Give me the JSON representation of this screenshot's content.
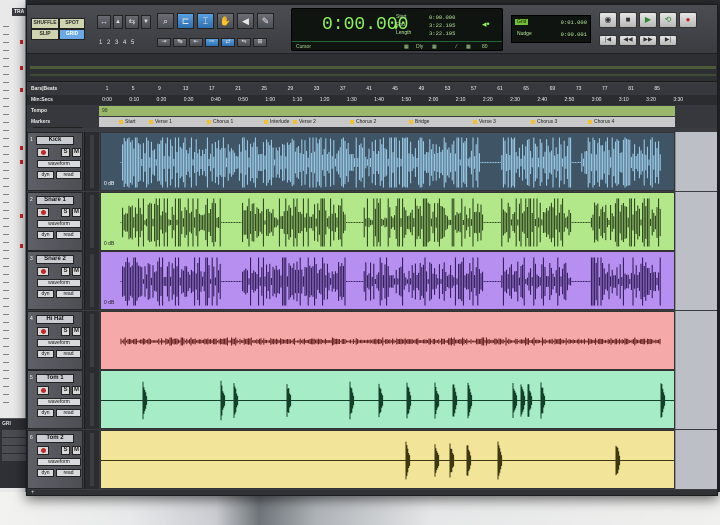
{
  "desktop": {
    "left_tab_label": "TRA",
    "grid_panel_label": "GRI"
  },
  "toolbar": {
    "edit_modes": [
      "SHUFFLE",
      "SPOT",
      "SLIP",
      "GRID"
    ],
    "zoom_presets": [
      "1",
      "2",
      "3",
      "4",
      "5"
    ],
    "icons": [
      "zoom-in-out-icon",
      "zoomer-tool-icon",
      "trim-tool-icon",
      "selector-tool-icon",
      "grabber-tool-icon",
      "scrubber-tool-icon",
      "pencil-tool-icon",
      "smart-tool-icon"
    ]
  },
  "counter": {
    "main": "0:00.000",
    "start_label": "Start",
    "start_value": "0:00.000",
    "end_label": "End",
    "end_value": "3:22.105",
    "length_label": "Length",
    "length_value": "3:22.105",
    "cursor_label": "Cursor",
    "dly_label": "Dly",
    "nudge_value_right": "80"
  },
  "grid": {
    "grid_label": "Grid",
    "grid_value": "0:01.000",
    "nudge_label": "Nudge",
    "nudge_value": "0:00.001"
  },
  "rulers": {
    "bars_label": "Bars|Beats",
    "minsec_label": "Min:Secs",
    "tempo_label": "Tempo",
    "markers_label": "Markers",
    "tempo_value": "99",
    "bars": [
      "1",
      "5",
      "9",
      "13",
      "17",
      "21",
      "25",
      "29",
      "33",
      "37",
      "41",
      "45",
      "49",
      "53",
      "57",
      "61",
      "65",
      "69",
      "73",
      "77",
      "81",
      "85"
    ],
    "minsecs": [
      "0:00",
      "0:10",
      "0:20",
      "0:30",
      "0:40",
      "0:50",
      "1:00",
      "1:10",
      "1:20",
      "1:30",
      "1:40",
      "1:50",
      "2:00",
      "2:10",
      "2:20",
      "2:30",
      "2:40",
      "2:50",
      "3:00",
      "3:10",
      "3:20",
      "3:30"
    ],
    "markers": [
      "Start",
      "Verse 1",
      "Chorus 1",
      "Interlude",
      "Verse 2",
      "Chorus 2",
      "Bridge",
      "Verse 3",
      "Chorus 3",
      "Chorus 4"
    ]
  },
  "tracks": [
    {
      "num": "1",
      "name": "Kick",
      "view": "waveform",
      "dyn": "dyn",
      "mode": "read",
      "gain": "0 dB",
      "color": "#8ab2d2",
      "wave": "#9fd2f0",
      "bg": "#3f5566"
    },
    {
      "num": "2",
      "name": "Snare 1",
      "view": "waveform",
      "dyn": "dyn",
      "mode": "read",
      "gain": "0 dB",
      "color": "#b2e88a",
      "wave": "#243a14",
      "bg": "#b2e88a"
    },
    {
      "num": "3",
      "name": "Snare 2",
      "view": "waveform",
      "dyn": "dyn",
      "mode": "read",
      "gain": "0 dB",
      "color": "#b68ff0",
      "wave": "#2a1550",
      "bg": "#b68ff0"
    },
    {
      "num": "4",
      "name": "Hi Hat",
      "view": "waveform",
      "dyn": "dyn",
      "mode": "read",
      "gain": "",
      "color": "#f5a9a9",
      "wave": "#5a1515",
      "bg": "#f5a9a9"
    },
    {
      "num": "5",
      "name": "Tom 1",
      "view": "waveform",
      "dyn": "dyn",
      "mode": "read",
      "gain": "",
      "color": "#a6ecc6",
      "wave": "#14402a",
      "bg": "#a6ecc6"
    },
    {
      "num": "6",
      "name": "Tom 2",
      "view": "waveform",
      "dyn": "dyn",
      "mode": "read",
      "gain": "",
      "color": "#f2e59a",
      "wave": "#3d3810",
      "bg": "#f2e59a"
    }
  ],
  "bottom": {
    "label": "+"
  }
}
